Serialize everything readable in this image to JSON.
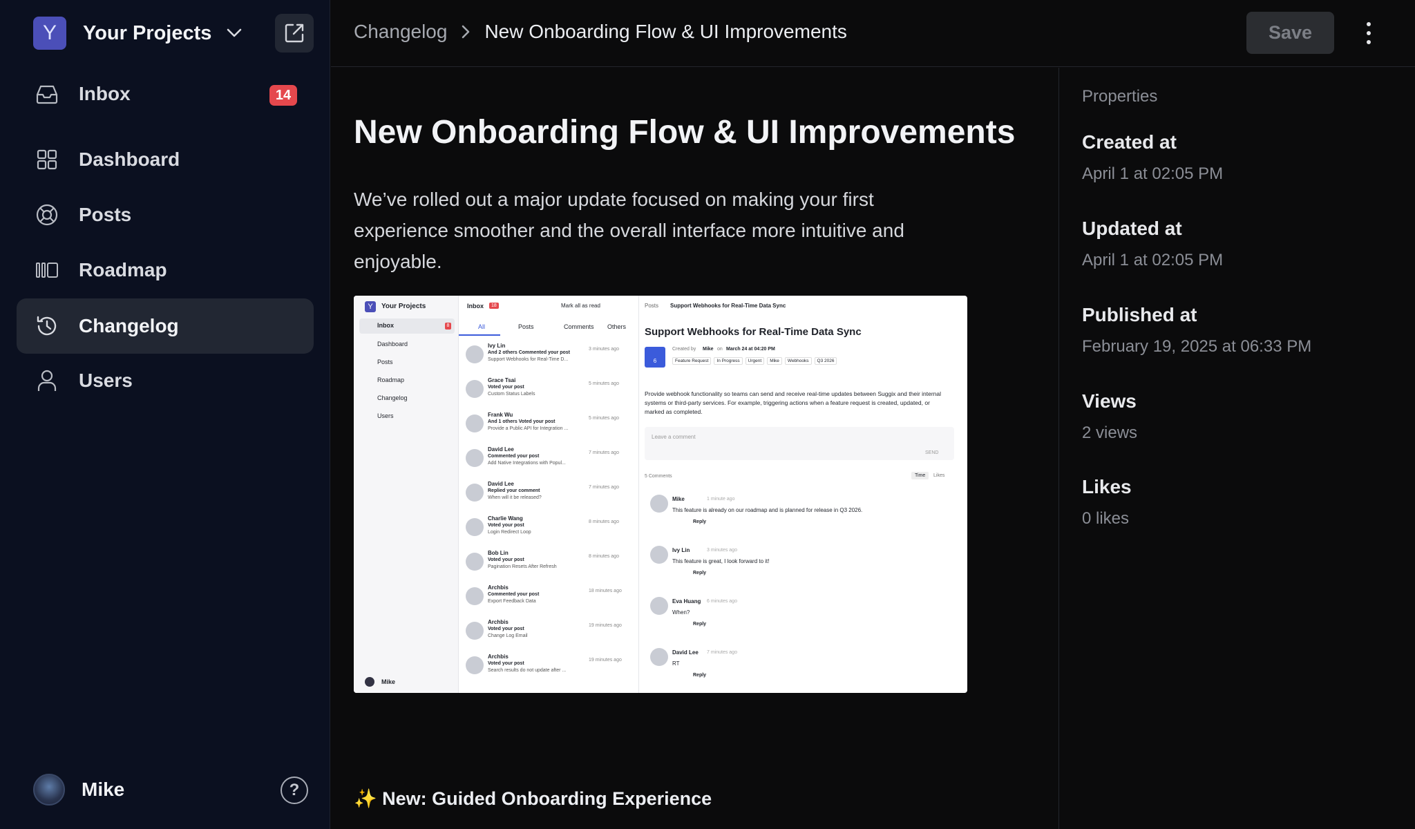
{
  "sidebar": {
    "project": {
      "initial": "Y",
      "name": "Your Projects"
    },
    "items": [
      {
        "label": "Inbox",
        "badge": "14"
      },
      {
        "label": "Dashboard"
      },
      {
        "label": "Posts"
      },
      {
        "label": "Roadmap"
      },
      {
        "label": "Changelog"
      },
      {
        "label": "Users"
      }
    ],
    "user": {
      "name": "Mike",
      "help_glyph": "?"
    }
  },
  "header": {
    "breadcrumb_root": "Changelog",
    "breadcrumb_current": "New Onboarding Flow & UI Improvements",
    "save_label": "Save"
  },
  "post": {
    "title": "New Onboarding Flow & UI Improvements",
    "intro": "We’ve rolled out a major update focused on making your first experience smoother and the overall interface more intuitive and enjoyable.",
    "section_heading": "✨ New: Guided Onboarding Experience"
  },
  "properties": {
    "title": "Properties",
    "items": [
      {
        "label": "Created at",
        "value": "April 1 at 02:05 PM"
      },
      {
        "label": "Updated at",
        "value": "April 1 at 02:05 PM"
      },
      {
        "label": "Published at",
        "value": "February 19, 2025 at 06:33 PM"
      },
      {
        "label": "Views",
        "value": "2 views"
      },
      {
        "label": "Likes",
        "value": "0 likes"
      }
    ]
  },
  "embedded_screenshot": {
    "sidebar": {
      "project": "Your Projects",
      "initial": "Y",
      "items": [
        "Inbox",
        "Dashboard",
        "Posts",
        "Roadmap",
        "Changelog",
        "Users"
      ],
      "inbox_badge": "8",
      "user": "Mike"
    },
    "inbox": {
      "title": "Inbox",
      "count": "18",
      "mark_all": "Mark all as read",
      "tabs": [
        "All",
        "Posts",
        "Comments",
        "Others"
      ],
      "rows": [
        {
          "name": "Ivy Lin",
          "action": "And 2 others Commented your post",
          "detail": "Support Webhooks for Real-Time D...",
          "time": "3 minutes ago"
        },
        {
          "name": "Grace Tsai",
          "action": "Voted your post",
          "detail": "Custom Status Labels",
          "time": "5 minutes ago"
        },
        {
          "name": "Frank Wu",
          "action": "And 1 others Voted your post",
          "detail": "Provide a Public API for Integration ...",
          "time": "5 minutes ago"
        },
        {
          "name": "David Lee",
          "action": "Commented your post",
          "detail": "Add Native Integrations with Popul...",
          "time": "7 minutes ago"
        },
        {
          "name": "David Lee",
          "action": "Replied your comment",
          "detail": "When will it be released?",
          "time": "7 minutes ago"
        },
        {
          "name": "Charlie Wang",
          "action": "Voted your post",
          "detail": "Login Redirect Loop",
          "time": "8 minutes ago"
        },
        {
          "name": "Bob Lin",
          "action": "Voted your post",
          "detail": "Pagination Resets After Refresh",
          "time": "8 minutes ago"
        },
        {
          "name": "Archbis",
          "action": "Commented your post",
          "detail": "Export Feedback Data",
          "time": "18 minutes ago"
        },
        {
          "name": "Archbis",
          "action": "Voted your post",
          "detail": "Change Log Email",
          "time": "19 minutes ago"
        },
        {
          "name": "Archbis",
          "action": "Voted your post",
          "detail": "Search results do not update after ...",
          "time": "19 minutes ago"
        }
      ]
    },
    "detail": {
      "crumb_root": "Posts",
      "crumb_current": "Support Webhooks for Real-Time Data Sync",
      "title": "Support Webhooks for Real-Time Data Sync",
      "votes": "6",
      "created_by": "Created by",
      "author": "Mike",
      "on": "on",
      "date": "March 24 at 04:20 PM",
      "tags": [
        "Feature Request",
        "In Progress",
        "Urgent",
        "Mike",
        "Webhooks",
        "Q3 2026"
      ],
      "body": "Provide webhook functionality so teams can send and receive real-time updates between Suggix and their internal systems or third-party services. For example, triggering actions when a feature request is created, updated, or marked as completed.",
      "comment_placeholder": "Leave a comment",
      "send": "SEND",
      "comments_count": "5 Comments",
      "sort": [
        "Time",
        "Likes"
      ],
      "comments": [
        {
          "name": "Mike",
          "time": "1 minute ago",
          "text": "This feature is already on our roadmap and is planned for release in Q3 2026."
        },
        {
          "name": "Ivy Lin",
          "time": "3 minutes ago",
          "text": "This feature is great, I look forward to it!"
        },
        {
          "name": "Eva Huang",
          "time": "6 minutes ago",
          "text": "When?"
        },
        {
          "name": "David Lee",
          "time": "7 minutes ago",
          "text": "RT"
        }
      ],
      "reply": "Reply"
    }
  }
}
